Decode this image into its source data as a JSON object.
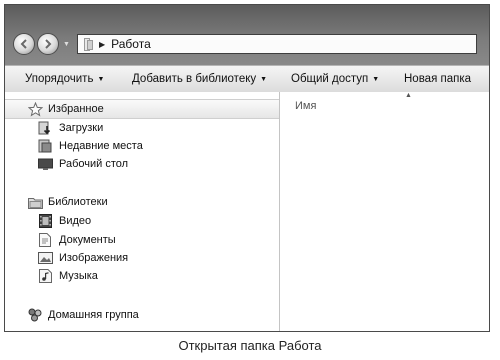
{
  "address": {
    "breadcrumb": "Работа"
  },
  "toolbar": {
    "organize": "Упорядочить",
    "add_to_library": "Добавить в библиотеку",
    "share": "Общий доступ",
    "new_folder": "Новая папка"
  },
  "navpane": {
    "favorites": {
      "label": "Избранное",
      "items": [
        "Загрузки",
        "Недавние места",
        "Рабочий стол"
      ]
    },
    "libraries": {
      "label": "Библиотеки",
      "items": [
        "Видео",
        "Документы",
        "Изображения",
        "Музыка"
      ]
    },
    "homegroup": {
      "label": "Домашняя группа"
    }
  },
  "filelist": {
    "column_name": "Имя"
  },
  "caption": "Открытая папка Работа"
}
